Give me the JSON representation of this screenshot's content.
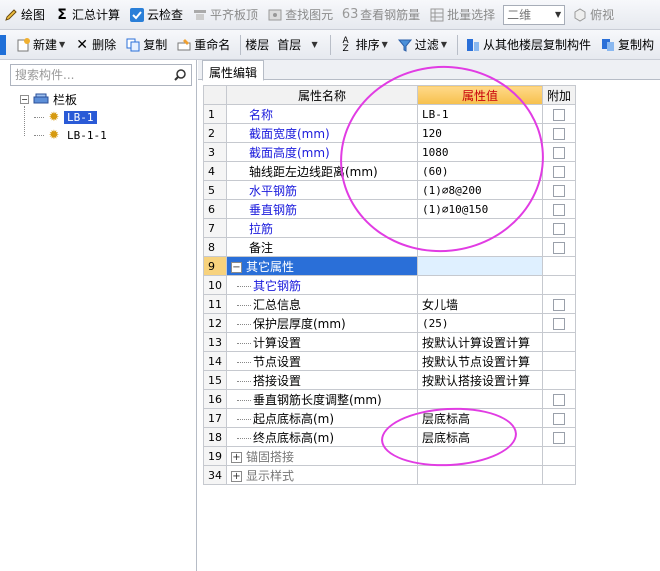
{
  "toolbar1": {
    "draw": "绘图",
    "sum_calc": "汇总计算",
    "cloud_check": "云检查",
    "align_top": "平齐板顶",
    "find_element": "查找图元",
    "view_rebar": "查看钢筋量",
    "batch_select": "批量选择",
    "view_mode": "二维",
    "top_view": "俯视"
  },
  "toolbar2": {
    "new": "新建",
    "delete": "删除",
    "copy": "复制",
    "rename": "重命名",
    "floor_label": "楼层",
    "floor_value": "首层",
    "sort": "排序",
    "filter": "过滤",
    "copy_from_other_floor": "从其他楼层复制构件",
    "copy_component": "复制构"
  },
  "left_panel": {
    "search_placeholder": "搜索构件...",
    "tree_root": "栏板",
    "tree_items": [
      "LB-1",
      "LB-1-1"
    ]
  },
  "right_panel": {
    "tab": "属性编辑",
    "columns": [
      "属性名称",
      "属性值",
      "附加"
    ],
    "rows": [
      {
        "num": "1",
        "name": "名称",
        "value": "LB-1"
      },
      {
        "num": "2",
        "name": "截面宽度(mm)",
        "value": "120"
      },
      {
        "num": "3",
        "name": "截面高度(mm)",
        "value": "1080"
      },
      {
        "num": "4",
        "name": "轴线距左边线距离(mm)",
        "value": "(60)"
      },
      {
        "num": "5",
        "name": "水平钢筋",
        "value": "(1)⌀8@200"
      },
      {
        "num": "6",
        "name": "垂直钢筋",
        "value": "(1)⌀10@150"
      },
      {
        "num": "7",
        "name": "拉筋",
        "value": ""
      },
      {
        "num": "8",
        "name": "备注",
        "value": ""
      },
      {
        "num": "9",
        "name": "其它属性",
        "value": ""
      },
      {
        "num": "10",
        "name": "其它钢筋",
        "value": ""
      },
      {
        "num": "11",
        "name": "汇总信息",
        "value": "女儿墙"
      },
      {
        "num": "12",
        "name": "保护层厚度(mm)",
        "value": "(25)"
      },
      {
        "num": "13",
        "name": "计算设置",
        "value": "按默认计算设置计算"
      },
      {
        "num": "14",
        "name": "节点设置",
        "value": "按默认节点设置计算"
      },
      {
        "num": "15",
        "name": "搭接设置",
        "value": "按默认搭接设置计算"
      },
      {
        "num": "16",
        "name": "垂直钢筋长度调整(mm)",
        "value": ""
      },
      {
        "num": "17",
        "name": "起点底标高(m)",
        "value": "层底标高"
      },
      {
        "num": "18",
        "name": "终点底标高(m)",
        "value": "层底标高"
      },
      {
        "num": "19",
        "name": "锚固搭接",
        "value": ""
      },
      {
        "num": "34",
        "name": "显示样式",
        "value": ""
      }
    ]
  },
  "colors": {
    "selection_blue": "#2a6fd8",
    "attr_name_blue": "#1a1adc",
    "value_header_red": "#c8000a",
    "annotation_magenta": "#e13ce3"
  }
}
